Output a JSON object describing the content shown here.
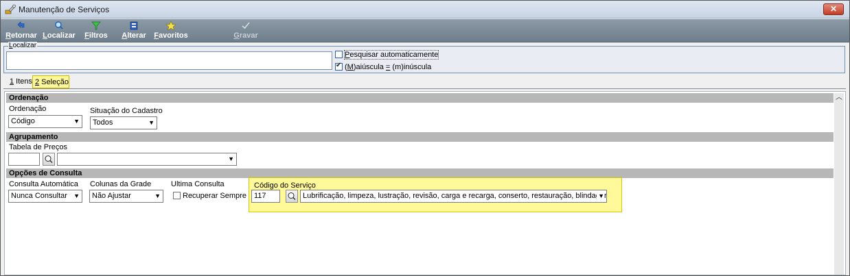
{
  "window": {
    "title": "Manutenção de Serviços",
    "close_glyph": "✕"
  },
  "toolbar": {
    "retornar": {
      "pre": "",
      "u": "R",
      "post": "etornar",
      "icon": "return-icon"
    },
    "localizar": {
      "pre": "",
      "u": "L",
      "post": "ocalizar",
      "icon": "search-icon"
    },
    "filtros": {
      "pre": "",
      "u": "F",
      "post": "iltros",
      "icon": "filter-icon"
    },
    "alterar": {
      "pre": "",
      "u": "A",
      "post": "lterar",
      "icon": "edit-icon"
    },
    "favoritos": {
      "pre": "",
      "u": "F",
      "post": "avoritos",
      "icon": "star-icon"
    },
    "gravar": {
      "pre": "",
      "u": "G",
      "post": "ravar",
      "icon": "check-icon",
      "disabled": true
    }
  },
  "localizar": {
    "legend_u": "L",
    "legend_rest": "ocalizar",
    "value": "",
    "auto_search": {
      "u": "P",
      "rest": "esquisar automaticamente",
      "checked": false
    },
    "case": {
      "u": "M",
      "pre": "(",
      "rest": ")aiúscula ",
      "eq": "=",
      "tail": " (m)inúscula",
      "checked": true
    }
  },
  "tabs": [
    {
      "u": "1",
      "rest": " Itens",
      "active": false
    },
    {
      "u": "2",
      "rest": " Seleção",
      "active": true
    }
  ],
  "sections": {
    "ordenacao": {
      "header": "Ordenação",
      "ordenacao_label": "Ordenação",
      "ordenacao_value": "Código",
      "situacao_label": "Situação do Cadastro",
      "situacao_value": "Todos"
    },
    "agrupamento": {
      "header": "Agrupamento",
      "tabela_label": "Tabela de Preços",
      "tabela_code": "",
      "tabela_value": ""
    },
    "opcoes": {
      "header": "Opções de Consulta",
      "consulta_label": "Consulta Automática",
      "consulta_value": "Nunca Consultar",
      "colunas_label": "Colunas da Grade",
      "colunas_value": "Não Ajustar",
      "ultima_label": "Ultima Consulta",
      "recuperar_label": "Recuperar Sempre",
      "recuperar_checked": false,
      "codigo_label": "Código do Serviço",
      "codigo_value": "117",
      "servico_value": "Lubrificação, limpeza, lustração, revisão, carga e recarga, conserto, restauração, blindagem"
    }
  },
  "colors": {
    "toolbar_bg": "#7d8b98",
    "section_header": "#b7b7b7",
    "highlight": "#fff99a",
    "close_button": "#c94a37"
  }
}
